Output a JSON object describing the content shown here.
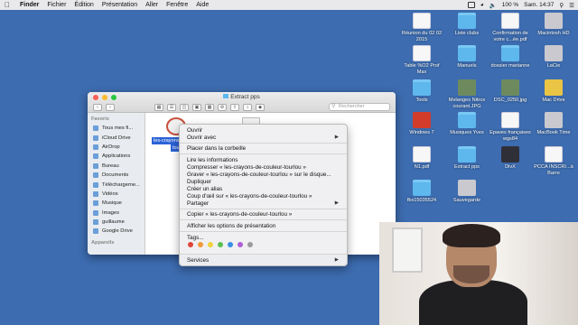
{
  "menubar": {
    "app": "Finder",
    "items": [
      "Fichier",
      "Édition",
      "Présentation",
      "Aller",
      "Fenêtre",
      "Aide"
    ],
    "battery": "100 %",
    "clock": "Sam. 14:37"
  },
  "desktop_icons": [
    {
      "label": "Réunion du 02 02 2015",
      "icon": "document-icon"
    },
    {
      "label": "Liste clubs",
      "icon": "folder-icon"
    },
    {
      "label": "Confirmation de votre c...ée.pdf",
      "icon": "document-icon"
    },
    {
      "label": "Macintosh HD",
      "icon": "disk-icon"
    },
    {
      "label": "Table %O2 Prof Max",
      "icon": "document-icon"
    },
    {
      "label": "Manuels",
      "icon": "folder-icon"
    },
    {
      "label": "dossier marianne",
      "icon": "folder-icon"
    },
    {
      "label": "LaCie",
      "icon": "disk-icon"
    },
    {
      "label": "Tools",
      "icon": "folder-icon"
    },
    {
      "label": "Melanges Nitrox courant.JPG",
      "icon": "photo-icon"
    },
    {
      "label": "DSC_0250.jpg",
      "icon": "photo-icon"
    },
    {
      "label": "Mac Drive",
      "icon": "app-icon"
    },
    {
      "label": "Windows 7",
      "icon": "app-icon"
    },
    {
      "label": "Musiques Yves",
      "icon": "folder-icon"
    },
    {
      "label": "Epaves françaises wgs84",
      "icon": "document-icon"
    },
    {
      "label": "MacBook Time",
      "icon": "disk-icon"
    },
    {
      "label": "N1.pdf",
      "icon": "document-icon"
    },
    {
      "label": "Extract pps",
      "icon": "folder-icon"
    },
    {
      "label": "DivX",
      "icon": "app-icon"
    },
    {
      "label": "PCCA INSCRI...à Barre",
      "icon": "document-icon"
    },
    {
      "label": "fbx15035524",
      "icon": "folder-icon"
    },
    {
      "label": "Sauvegarde",
      "icon": "disk-icon"
    }
  ],
  "finder": {
    "title": "Extract pps",
    "search_placeholder": "Rechercher",
    "sidebar_header": "Favoris",
    "sidebar_items": [
      "Tous mes fi...",
      "iCloud Drive",
      "AirDrop",
      "Applications",
      "Bureau",
      "Documents",
      "Téléchargeme...",
      "Vidéos",
      "Musique",
      "Images",
      "guillaume",
      "Google Drive"
    ],
    "sidebar_footer": "Appareils",
    "file_label_1": "les-crayons-",
    "file_label_2": "tou"
  },
  "context_menu": {
    "open": "Ouvrir",
    "open_with": "Ouvrir avec",
    "trash": "Placer dans la corbeille",
    "get_info": "Lire les informations",
    "compress": "Compresser « les-crayons-de-couleur-tourlou »",
    "burn": "Graver « les-crayons-de-couleur-tourlou » sur le disque...",
    "duplicate": "Dupliquer",
    "alias": "Créer un alias",
    "quicklook": "Coup d'œil sur « les-crayons-de-couleur-tourlou »",
    "share": "Partager",
    "copy": "Copier « les-crayons-de-couleur-tourlou »",
    "view_options": "Afficher les options de présentation",
    "tags": "Tags...",
    "services": "Services",
    "tag_colors": [
      "#e0453a",
      "#f29a38",
      "#efd23d",
      "#5cc04e",
      "#3a8ee6",
      "#b15ed6",
      "#9a9a9a"
    ]
  }
}
